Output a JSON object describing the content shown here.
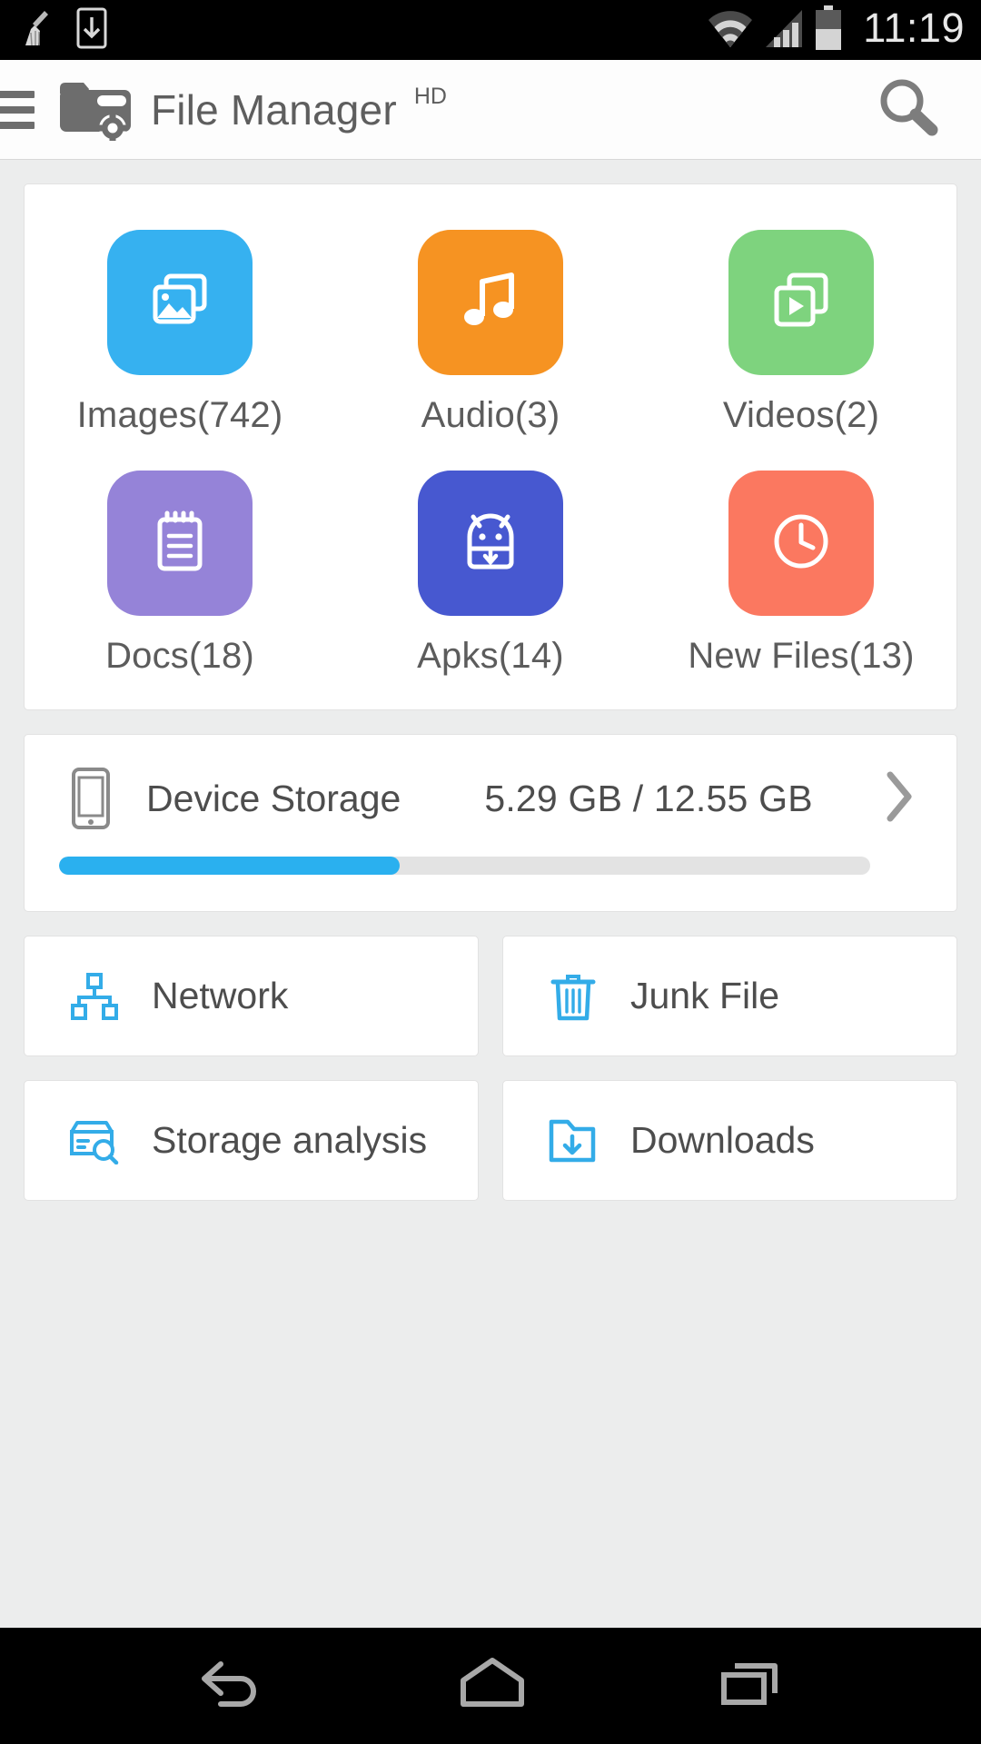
{
  "status_bar": {
    "time": "11:19",
    "icons": [
      "broom-icon",
      "download-indicator-icon",
      "wifi-icon",
      "cellular-signal-icon",
      "battery-icon"
    ]
  },
  "app_bar": {
    "menu_icon": "hamburger-menu-icon",
    "logo_icon": "folder-gear-logo-icon",
    "title": "File Manager",
    "title_superscript": "HD",
    "search_icon": "search-icon"
  },
  "categories": [
    {
      "label": "Images(742)",
      "name": "images",
      "icon": "photo-stack-icon",
      "color": "#36b1f0"
    },
    {
      "label": "Audio(3)",
      "name": "audio",
      "icon": "music-note-icon",
      "color": "#f69322"
    },
    {
      "label": "Videos(2)",
      "name": "videos",
      "icon": "video-stack-icon",
      "color": "#7ed37e"
    },
    {
      "label": "Docs(18)",
      "name": "docs",
      "icon": "notepad-icon",
      "color": "#9583d8"
    },
    {
      "label": "Apks(14)",
      "name": "apks",
      "icon": "android-robot-icon",
      "color": "#4758d0"
    },
    {
      "label": "New Files(13)",
      "name": "new-files",
      "icon": "clock-icon",
      "color": "#fb7860"
    }
  ],
  "storage": {
    "icon": "phone-device-icon",
    "label": "Device Storage",
    "value": "5.29 GB / 12.55 GB",
    "used_gb": 5.29,
    "total_gb": 12.55,
    "percent": 42,
    "bar_color": "#2ab0ef",
    "chevron_icon": "chevron-right-icon"
  },
  "tiles": [
    {
      "label": "Network",
      "name": "network",
      "icon": "sitemap-network-icon"
    },
    {
      "label": "Junk File",
      "name": "junk-file",
      "icon": "trash-bin-icon"
    },
    {
      "label": "Storage analysis",
      "name": "storage-analysis",
      "icon": "drive-search-icon"
    },
    {
      "label": "Downloads",
      "name": "downloads",
      "icon": "folder-download-icon"
    }
  ],
  "nav_bar": {
    "back": "back-arrow-icon",
    "home": "home-icon",
    "recents": "recents-icon"
  },
  "theme": {
    "accent": "#2ab0ef",
    "page_bg": "#eceded",
    "card_bg": "#ffffff",
    "text": "#4d4d4d"
  }
}
